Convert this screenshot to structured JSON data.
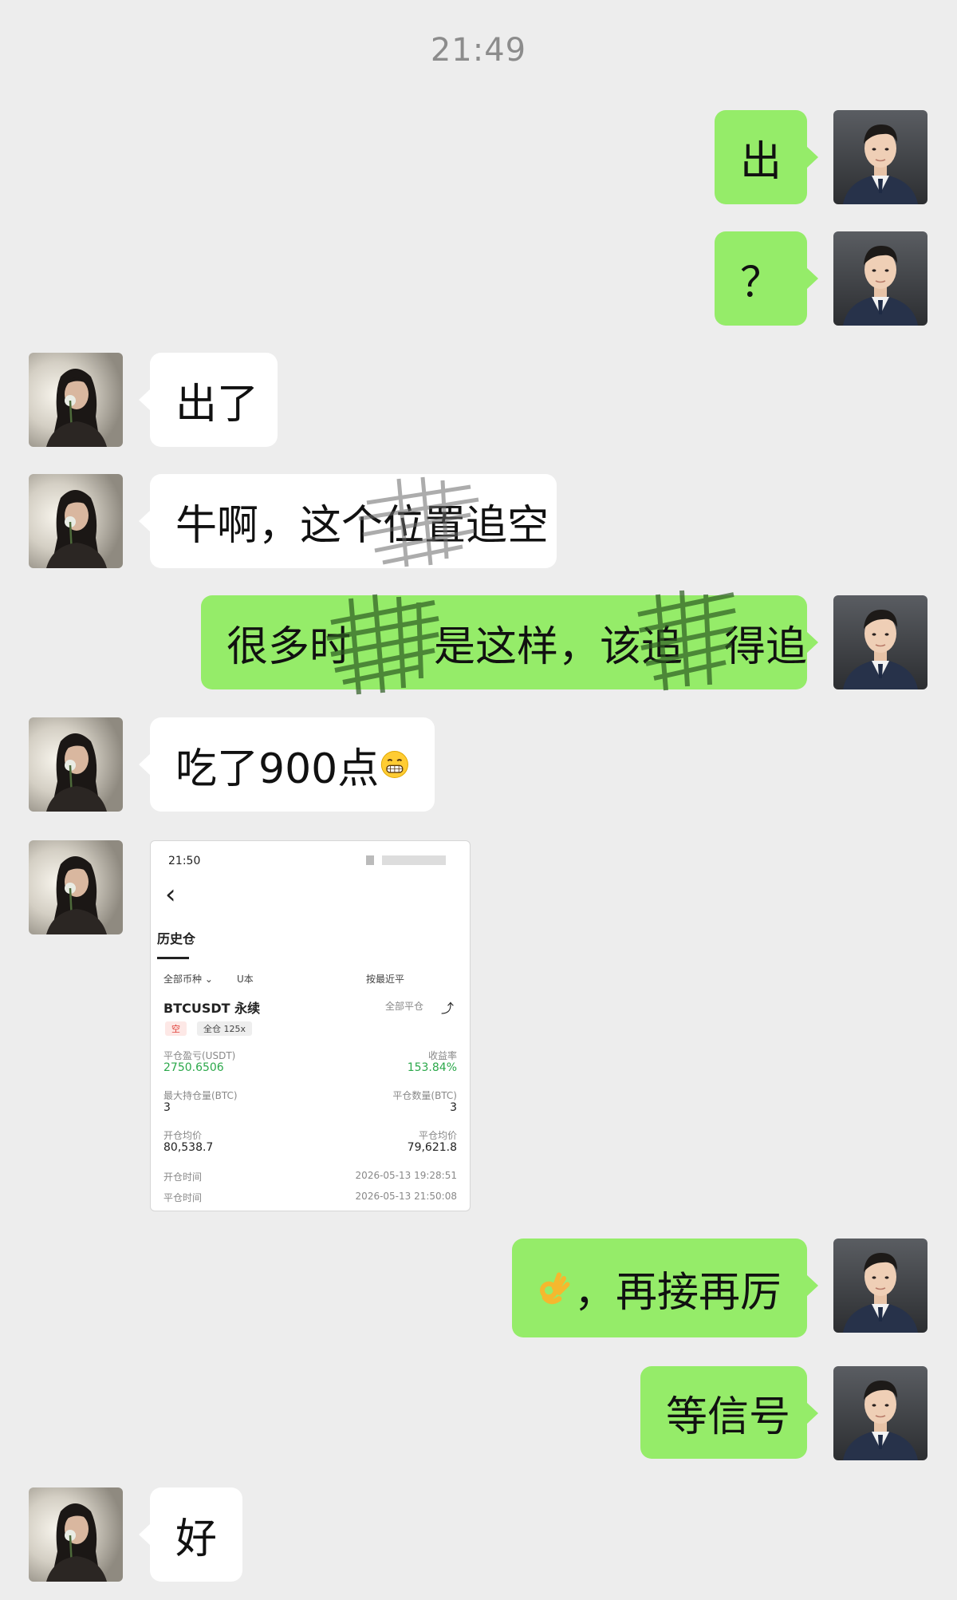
{
  "chat": {
    "timestamp": "21:49",
    "messages": {
      "m1": "出",
      "m2": "？",
      "m3": "出了",
      "m4": "牛啊，这个位置追空",
      "m5": "很多时　　是这样，该追　得追",
      "m6_text": "吃了900点",
      "m8_text": "，再接再厉",
      "m9": "等信号",
      "m10": "好"
    },
    "icons": {
      "m6_emoji": "grinning-face-emoji",
      "m8_emoji": "ok-hand-emoji"
    }
  },
  "screenshot_card": {
    "status_time": "21:50",
    "back": "‹",
    "title": "历史仓",
    "filter_all": "全部币种 ⌄",
    "filter_u": "U本",
    "sort": "按最近平",
    "pair": "BTCUSDT 永续",
    "close_all": "全部平仓",
    "side_tag": "空",
    "margin_tag": "全仓 125x",
    "pnl_label": "平仓盈亏(USDT)",
    "pnl_value": "2750.6506",
    "roe_label": "收益率",
    "roe_value": "153.84%",
    "max_pos_label": "最大持仓量(BTC)",
    "max_pos_value": "3",
    "close_qty_label": "平仓数量(BTC)",
    "close_qty_value": "3",
    "open_avg_label": "开仓均价",
    "open_avg_value": "80,538.7",
    "close_avg_label": "平仓均价",
    "close_avg_value": "79,621.8",
    "open_time_label": "开仓时间",
    "open_time_value": "2026-05-13 19:28:51",
    "close_time_label": "平仓时间",
    "close_time_value": "2026-05-13 21:50:08"
  },
  "colors": {
    "background": "#ededed",
    "my_bubble": "#95ec69",
    "their_bubble": "#ffffff",
    "profit_green": "#2ba84a",
    "short_red": "#e0403a"
  }
}
